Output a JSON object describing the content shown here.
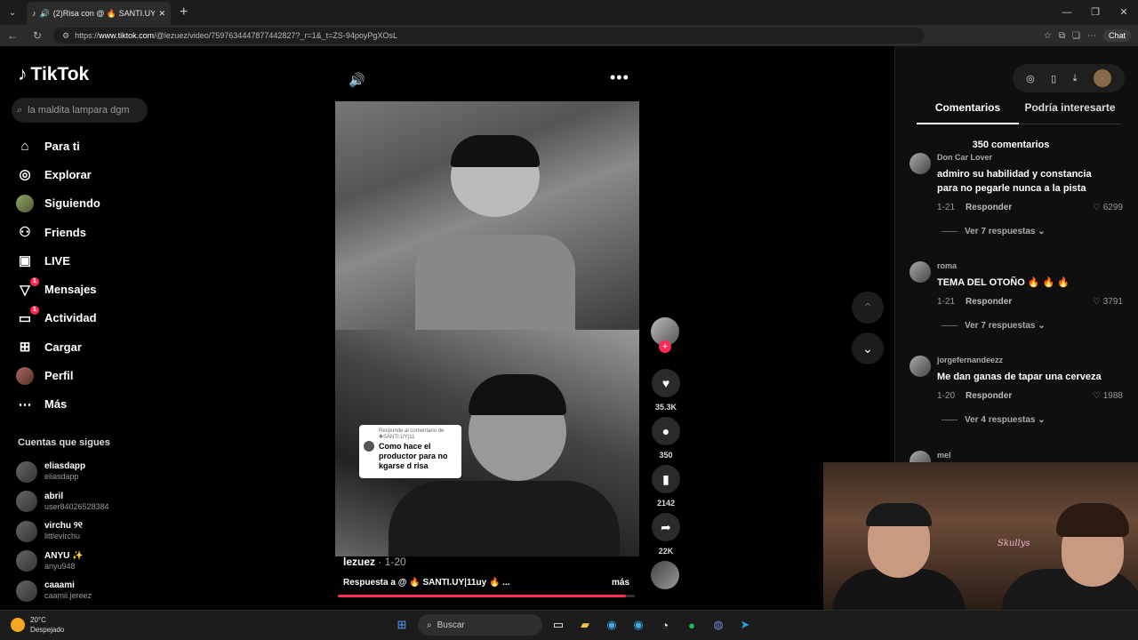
{
  "browser": {
    "tab_title": "(2)Risa con @ 🔥 SANTI.UY y",
    "url_prefix": "https://",
    "url_domain": "www.tiktok.com",
    "url_path": "/@lezuez/video/7597634447877442827?_r=1&_t=ZS-94poyPgXOsL",
    "chat_label": "Chat"
  },
  "sidebar": {
    "logo": "TikTok",
    "search_placeholder": "la maldita lampara dgm",
    "items": [
      {
        "label": "Para ti",
        "icon": "home-icon"
      },
      {
        "label": "Explorar",
        "icon": "compass-icon"
      },
      {
        "label": "Siguiendo",
        "icon": "avatar-icon"
      },
      {
        "label": "Friends",
        "icon": "friends-icon"
      },
      {
        "label": "LIVE",
        "icon": "live-icon"
      },
      {
        "label": "Mensajes",
        "icon": "message-icon",
        "badge": "1"
      },
      {
        "label": "Actividad",
        "icon": "activity-icon",
        "badge": "1"
      },
      {
        "label": "Cargar",
        "icon": "upload-icon"
      },
      {
        "label": "Perfil",
        "icon": "profile-icon"
      },
      {
        "label": "Más",
        "icon": "more-icon"
      }
    ],
    "following_title": "Cuentas que sigues",
    "following": [
      {
        "name": "eliasdapp",
        "user": "eliasdapp"
      },
      {
        "name": "abril",
        "user": "user84026528384"
      },
      {
        "name": "virchu ୨୧",
        "user": "littlevirchu"
      },
      {
        "name": "ANYU ✨",
        "user": "anyu948"
      },
      {
        "name": "caaami",
        "user": "caamii.jereez"
      }
    ]
  },
  "video": {
    "reply_header": "Responde al comentario de ✚SANTI.UY|11",
    "reply_text": "Como hace el productor para no kgarse d risa",
    "author": "lezuez",
    "date": " · 1-20",
    "description": "Respuesta a @ 🔥 SANTI.UY|11uy 🔥 ...",
    "more_label": "más",
    "progress": 0.97
  },
  "actions": {
    "likes": "35.3K",
    "comments": "350",
    "saves": "2142",
    "shares": "22K"
  },
  "comments_panel": {
    "tab_comments": "Comentarios",
    "tab_interesting": "Podría interesarte",
    "count": "350 comentarios",
    "reply_label": "Responder",
    "items": [
      {
        "name": "Don Car Lover",
        "text": "admiro su habilidad y constancia para no pegarle nunca a la pista",
        "date": "1-21",
        "likes": "6299",
        "more": "Ver 7 respuestas"
      },
      {
        "name": "roma",
        "text": "TEMA DEL OTOÑO 🔥 🔥 🔥",
        "date": "1-21",
        "likes": "3791",
        "more": "Ver 7 respuestas"
      },
      {
        "name": "jorgefernandeezz",
        "text": "Me dan ganas de tapar una cerveza",
        "date": "1-20",
        "likes": "1988",
        "more": "Ver 4 respuestas"
      },
      {
        "name": "mel"
      }
    ]
  },
  "webcam": {
    "neon_text": "Skullys"
  },
  "taskbar": {
    "temp": "20°C",
    "weather": "Despejado",
    "search_label": "Buscar"
  },
  "colors": {
    "accent": "#fe2c55",
    "background": "#000000"
  }
}
